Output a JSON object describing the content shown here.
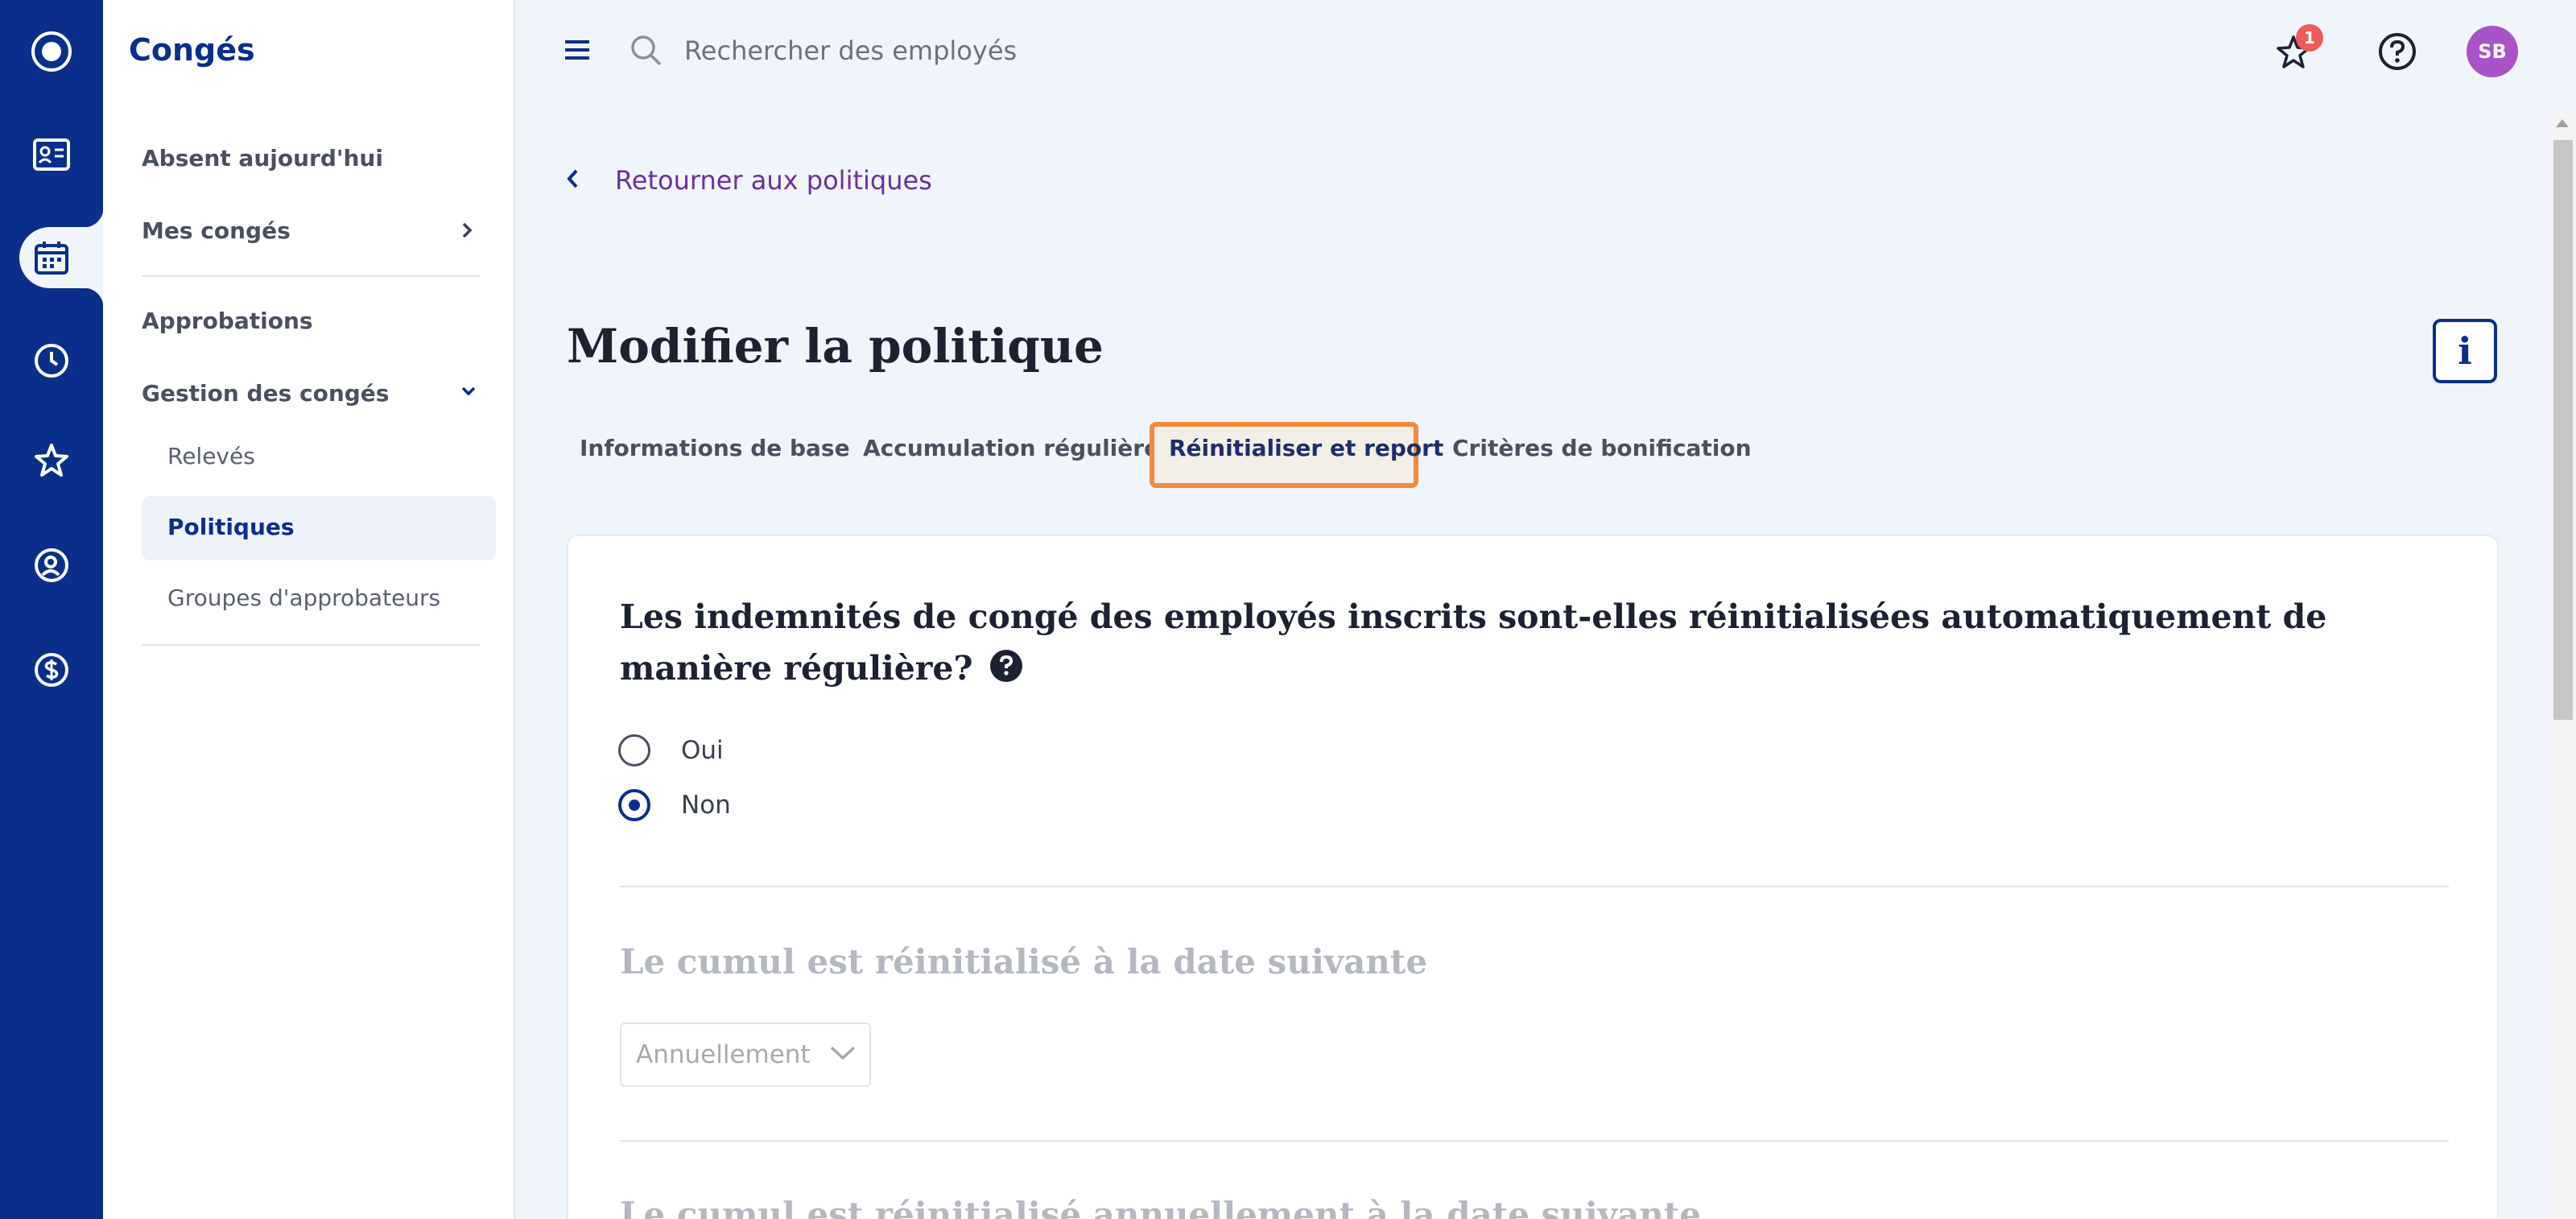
{
  "sidebar": {
    "title": "Congés",
    "items": [
      {
        "label": "Absent aujourd'hui"
      },
      {
        "label": "Mes congés"
      },
      {
        "label": "Approbations"
      },
      {
        "label": "Gestion des congés"
      }
    ],
    "sub_items": [
      {
        "label": "Relevés"
      },
      {
        "label": "Politiques"
      },
      {
        "label": "Groupes d'approbateurs"
      }
    ]
  },
  "topbar": {
    "search_placeholder": "Rechercher des employés",
    "notification_count": "1",
    "avatar_initials": "SB"
  },
  "main": {
    "back_label": "Retourner aux politiques",
    "page_title": "Modifier la politique",
    "info_label": "i",
    "tabs": [
      {
        "label": "Informations de base"
      },
      {
        "label": "Accumulation régulière"
      },
      {
        "label": "Réinitialiser et report"
      },
      {
        "label": "Critères de bonification"
      }
    ],
    "question": "Les indemnités de congé des employés inscrits sont-elles réinitialisées automatiquement de manière régulière?",
    "options": [
      {
        "label": "Oui",
        "checked": false
      },
      {
        "label": "Non",
        "checked": true
      }
    ],
    "section2_title": "Le cumul est réinitialisé à la date suivante",
    "frequency_value": "Annuellement",
    "section3_title": "Le cumul est réinitialisé annuellement à la date suivante"
  },
  "colors": {
    "rail": "#0a2f8b",
    "accent_purple": "#6b2fa0",
    "highlight_orange": "#f08a3c"
  }
}
